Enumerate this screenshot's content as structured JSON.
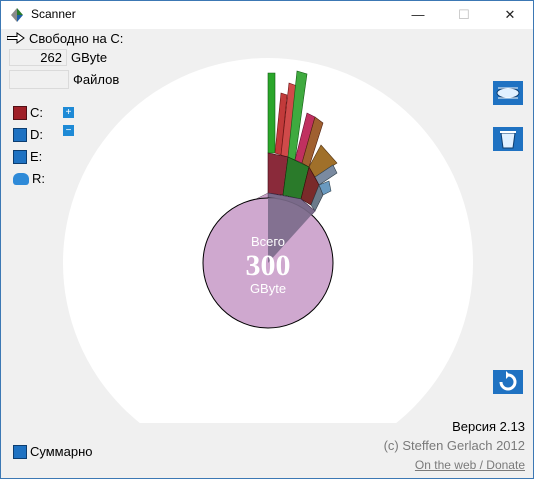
{
  "window": {
    "title": "Scanner",
    "min_glyph": "—",
    "max_glyph": "☐",
    "close_glyph": "✕"
  },
  "free": {
    "label": "Свободно на C:",
    "value": "262",
    "unit": "GByte"
  },
  "files": {
    "label": "Файлов"
  },
  "drives": [
    {
      "letter": "C:",
      "icon": "drive-c-icon"
    },
    {
      "letter": "D:",
      "icon": "drive-d-icon"
    },
    {
      "letter": "E:",
      "icon": "drive-e-icon"
    },
    {
      "letter": "R:",
      "icon": "drive-r-icon"
    }
  ],
  "side_buttons": {
    "expand": "+",
    "collapse": "−"
  },
  "center": {
    "caption": "Всего",
    "value": "300",
    "unit": "GByte"
  },
  "colors": {
    "accent": "#1f72c2",
    "used_disk": "#cfa8cf",
    "outline": "#000000"
  },
  "footer": {
    "version": "Версия 2.13",
    "copyright": "(c) Steffen Gerlach 2012",
    "link": "On the web / Donate"
  },
  "summary": {
    "label": "Суммарно"
  }
}
